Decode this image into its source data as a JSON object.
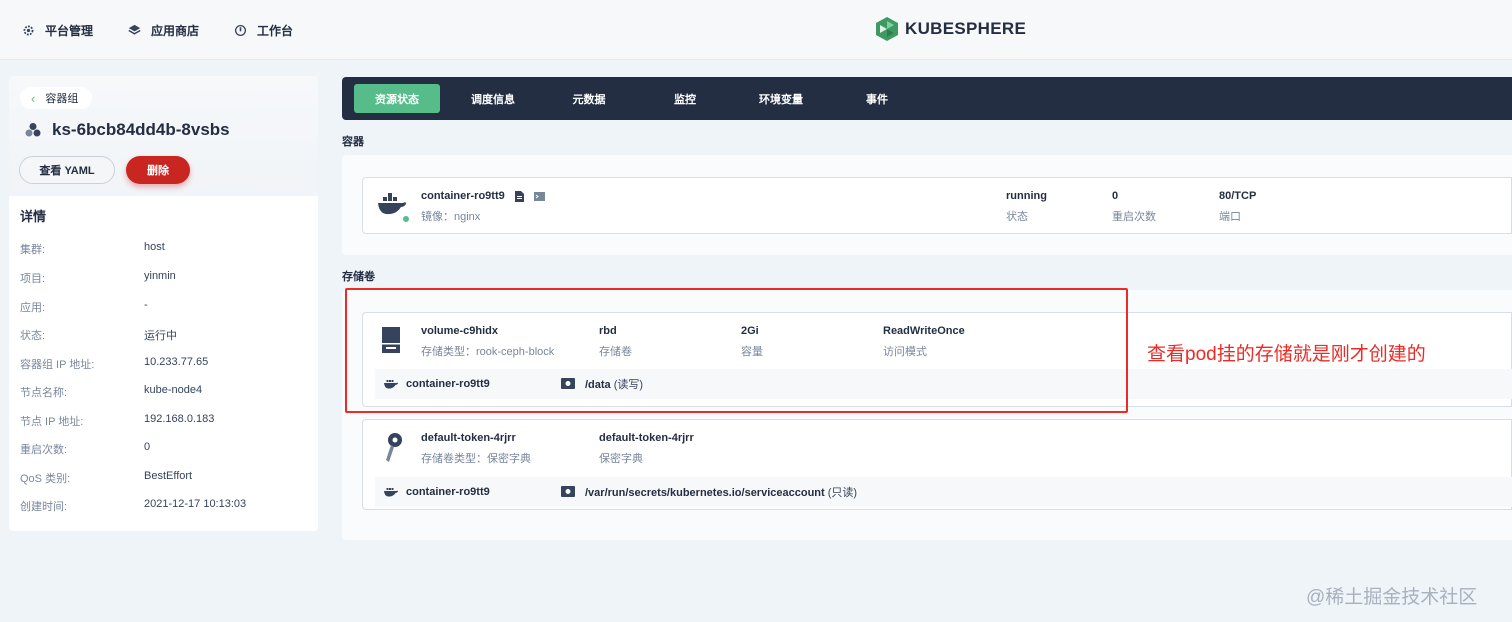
{
  "topnav": {
    "items": [
      {
        "label": "平台管理",
        "icon": "gear-icon"
      },
      {
        "label": "应用商店",
        "icon": "app-store-icon"
      },
      {
        "label": "工作台",
        "icon": "workbench-icon"
      }
    ],
    "logo_text": "KUBESPHERE"
  },
  "sidebar": {
    "back_label": "容器组",
    "pod_name": "ks-6bcb84dd4b-8vsbs",
    "view_yaml_label": "查看 YAML",
    "delete_label": "删除",
    "details_title": "详情",
    "details": [
      {
        "key": "集群:",
        "value": "host"
      },
      {
        "key": "项目:",
        "value": "yinmin"
      },
      {
        "key": "应用:",
        "value": "-"
      },
      {
        "key": "状态:",
        "value": "运行中"
      },
      {
        "key": "容器组 IP 地址:",
        "value": "10.233.77.65"
      },
      {
        "key": "节点名称:",
        "value": "kube-node4"
      },
      {
        "key": "节点 IP 地址:",
        "value": "192.168.0.183"
      },
      {
        "key": "重启次数:",
        "value": "0"
      },
      {
        "key": "QoS 类别:",
        "value": "BestEffort"
      },
      {
        "key": "创建时间:",
        "value": "2021-12-17 10:13:03"
      }
    ]
  },
  "tabs": [
    {
      "label": "资源状态",
      "active": true
    },
    {
      "label": "调度信息",
      "active": false
    },
    {
      "label": "元数据",
      "active": false
    },
    {
      "label": "监控",
      "active": false
    },
    {
      "label": "环境变量",
      "active": false
    },
    {
      "label": "事件",
      "active": false
    }
  ],
  "containers_section": {
    "title": "容器",
    "container": {
      "name": "container-ro9tt9",
      "image": "镜像：nginx",
      "status_value": "running",
      "status_label": "状态",
      "restarts_value": "0",
      "restarts_label": "重启次数",
      "port_value": "80/TCP",
      "port_label": "端口"
    }
  },
  "volumes_section": {
    "title": "存储卷",
    "volumes": [
      {
        "name": "volume-c9hidx",
        "type": "存储类型：rook-ceph-block",
        "col2_value": "rbd",
        "col2_label": "存储卷",
        "col3_value": "2Gi",
        "col3_label": "容量",
        "col4_value": "ReadWriteOnce",
        "col4_label": "访问模式",
        "mount_container": "container-ro9tt9",
        "mount_path": "/data",
        "mount_mode": "(读写)"
      },
      {
        "name": "default-token-4rjrr",
        "type": "存储卷类型：保密字典",
        "col2_value": "default-token-4rjrr",
        "col2_label": "保密字典",
        "mount_container": "container-ro9tt9",
        "mount_path": "/var/run/secrets/kubernetes.io/serviceaccount",
        "mount_mode": "(只读)"
      }
    ]
  },
  "annotation": "查看pod挂的存储就是刚才创建的",
  "watermark": "@稀土掘金技术社区",
  "colors": {
    "accent_green": "#55bc8a",
    "danger_red": "#ca2621",
    "nav_dark": "#242e42",
    "annotation_red": "#ec2b26"
  }
}
